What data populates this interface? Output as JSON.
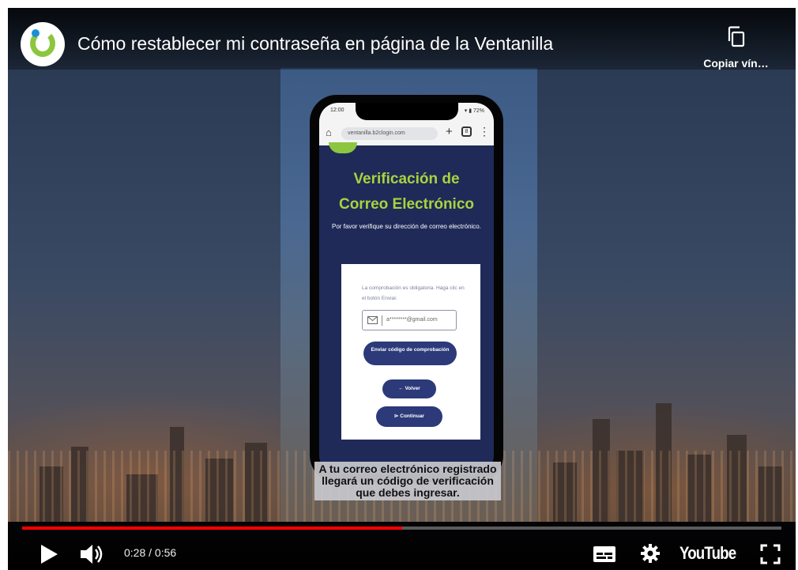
{
  "video": {
    "title": "Cómo restablecer mi contraseña en página de la Ventanilla",
    "copy_link_label": "Copiar vín…",
    "caption_lines": [
      "A tu correo electrónico registrado",
      "llegará un código de verificación",
      "que debes ingresar."
    ]
  },
  "phone": {
    "status_time": "12:00",
    "status_icons": "▾ ▮ 72%",
    "url": "ventanilla.b2clogin.com",
    "tabs_count": "8",
    "heading_line1": "Verificación de",
    "heading_line2": "Correo Electrónico",
    "subtitle": "Por favor verifique su dirección de correo electrónico.",
    "card_note": "La comprobación es obligatoria. Haga clic en el botón Enviar.",
    "email_value": "a********@gmail.com",
    "send_code_label": "Enviar código de comprobación",
    "back_label": "←  Volver",
    "continue_label": "⊳  Continuar"
  },
  "controls": {
    "current_time": "0:28",
    "duration": "0:56",
    "time_text": "0:28 / 0:56",
    "progress_fraction": 0.5,
    "youtube_label": "YouTube"
  },
  "colors": {
    "accent_red": "#ff0000",
    "heading_green": "#a8d33e",
    "button_navy": "#2c3a7a",
    "screen_navy": "#1f2a58"
  },
  "icons": [
    "channel-logo",
    "copy-icon",
    "play-icon",
    "volume-icon",
    "captions-icon",
    "gear-icon",
    "fullscreen-icon",
    "mail-icon"
  ]
}
